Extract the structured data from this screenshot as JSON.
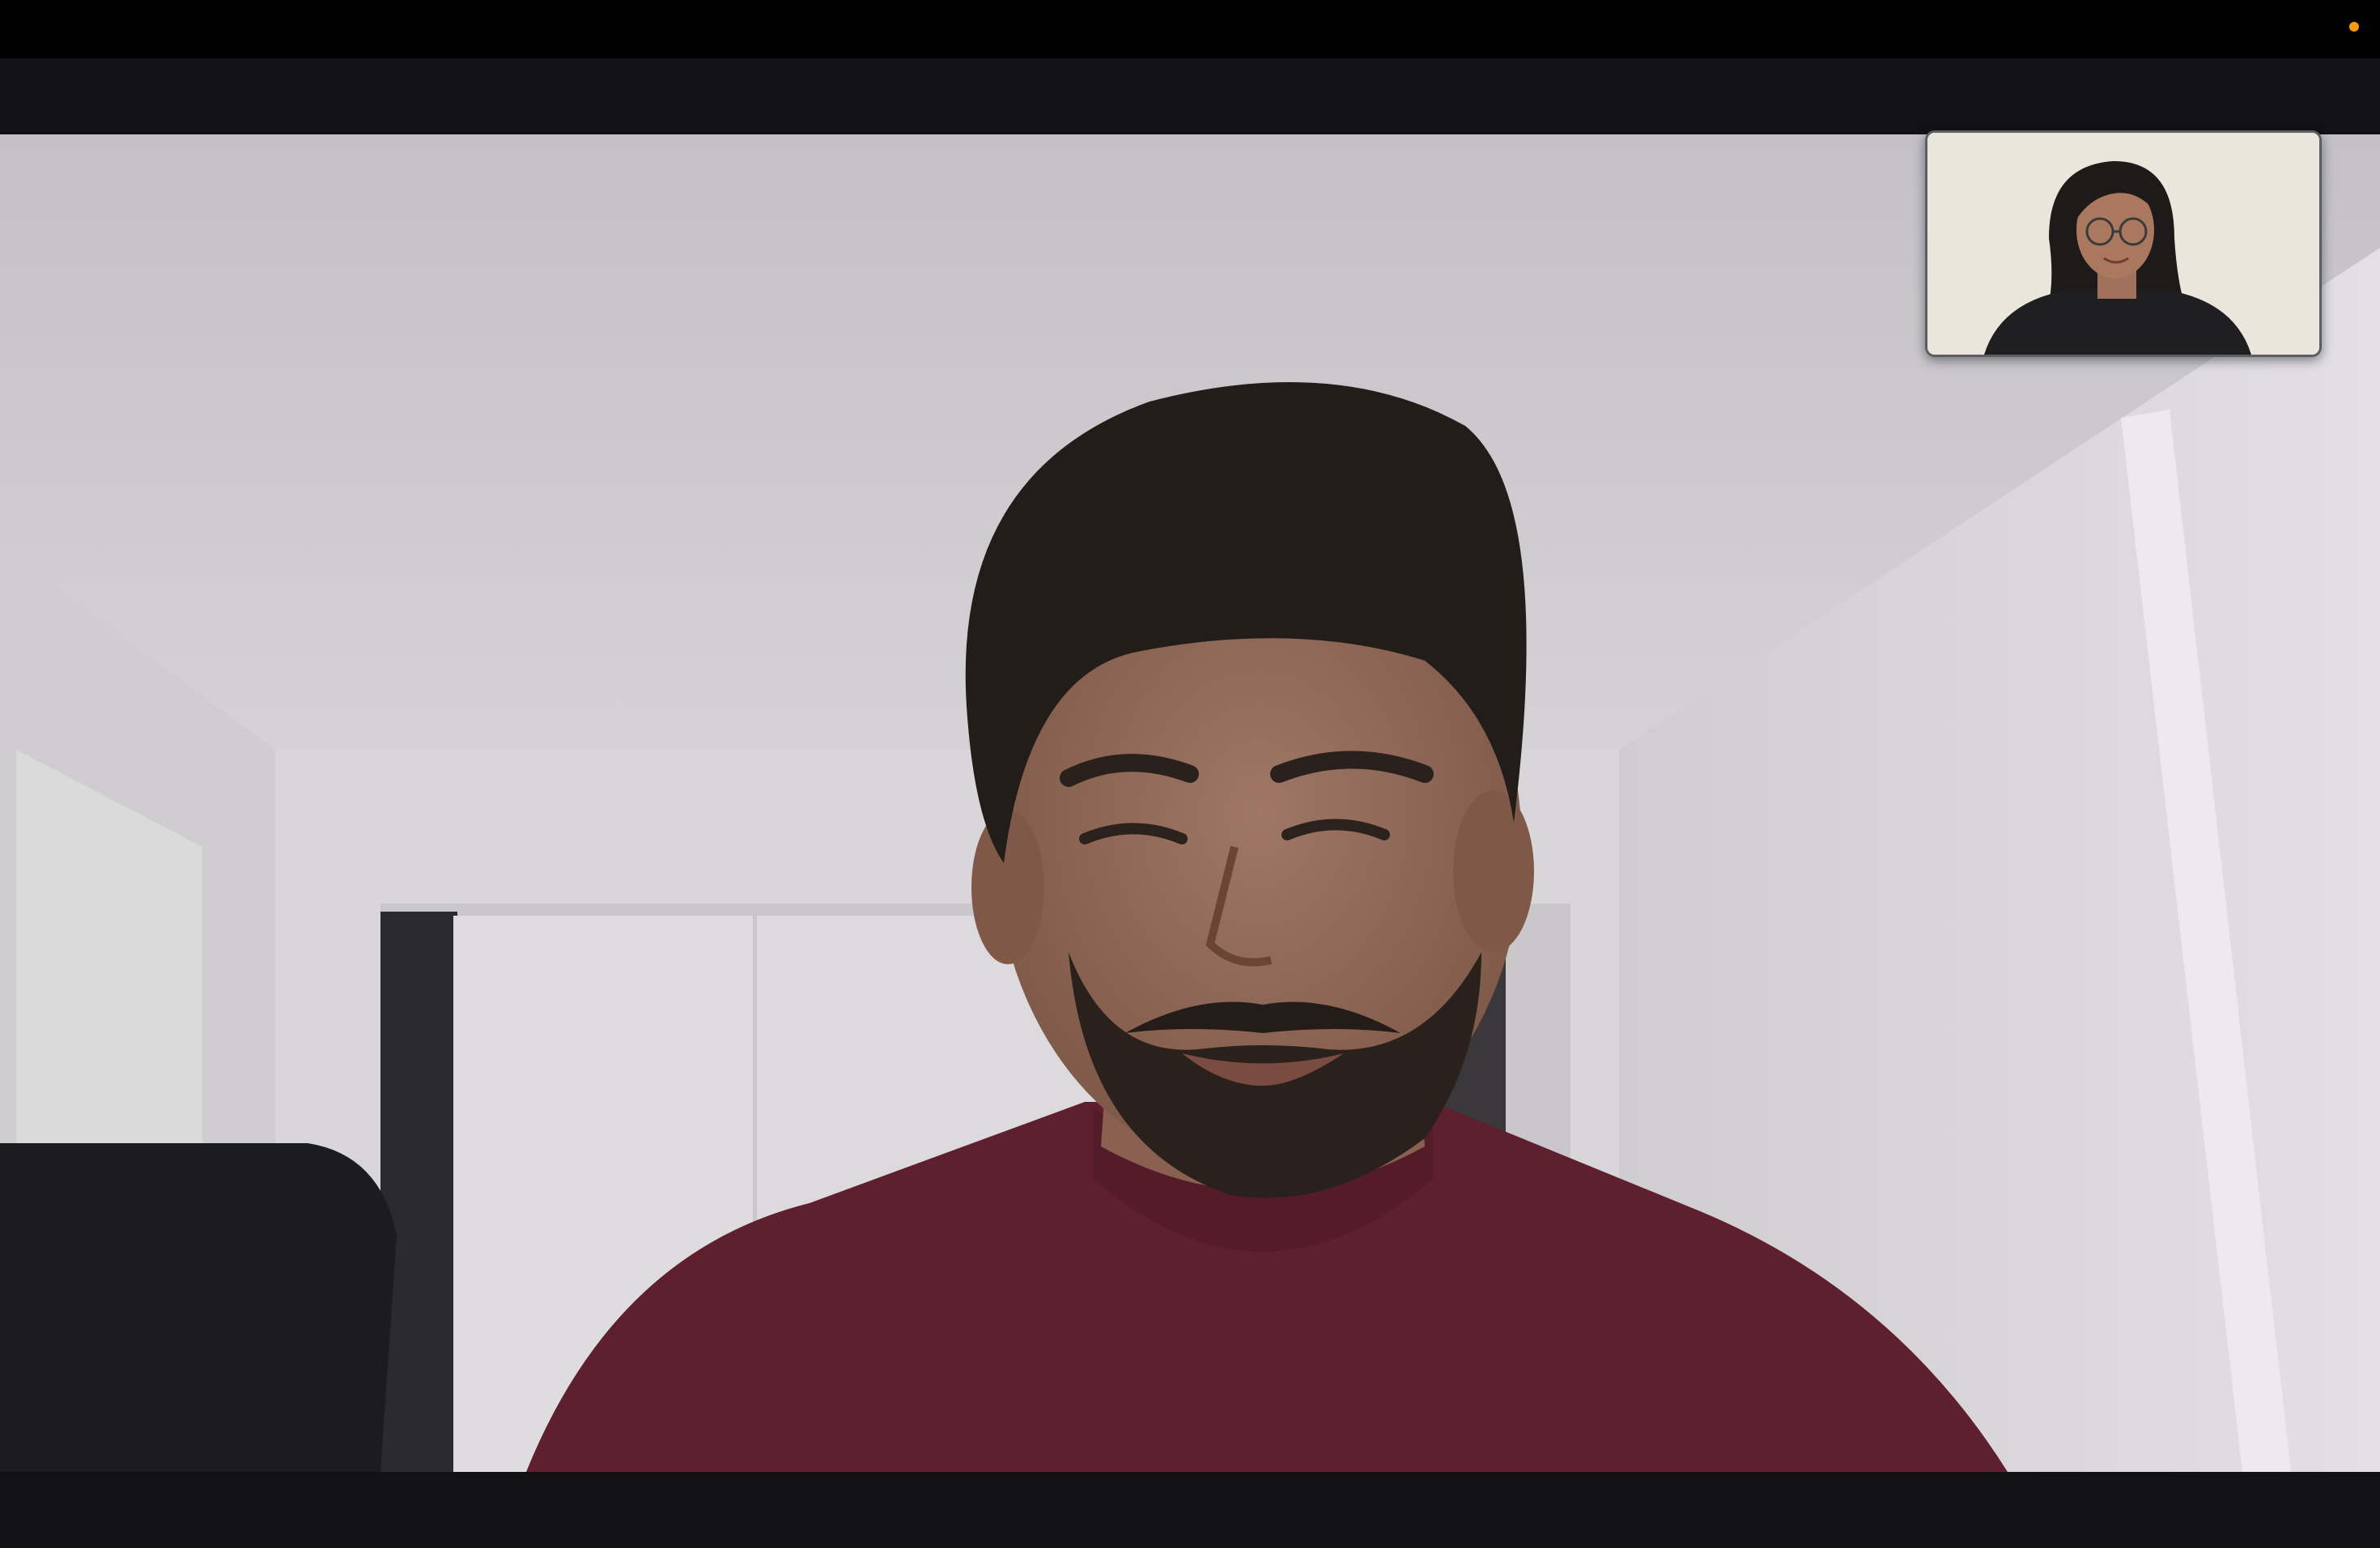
{
  "window": {
    "menubar_color": "#000000",
    "background_color": "#121214"
  },
  "status": {
    "mic_indicator_color": "#f39c12",
    "mic_indicator_icon": "microphone-in-use-dot"
  },
  "main_video": {
    "participant": "remote-participant",
    "shirt_color": "#5e1f2e"
  },
  "self_view": {
    "participant": "local-participant",
    "shirt_color": "#1f1f22"
  }
}
